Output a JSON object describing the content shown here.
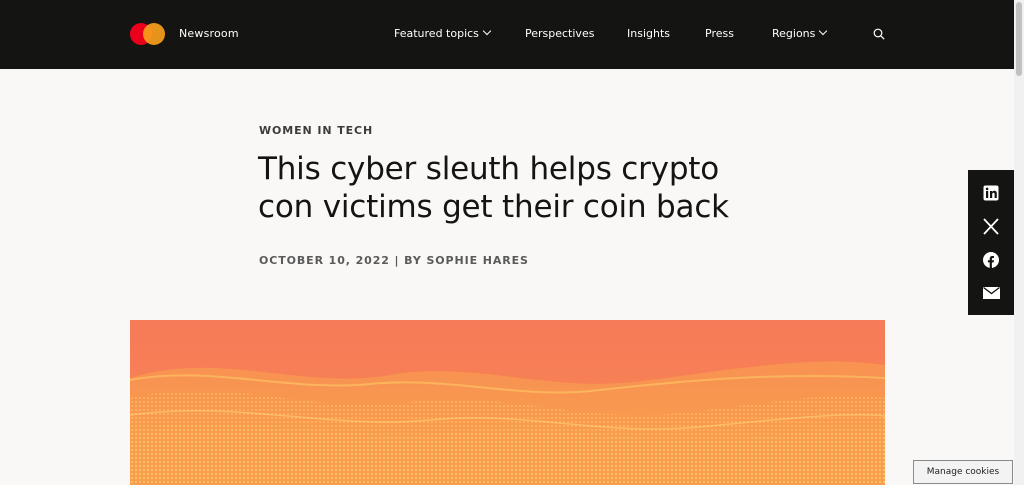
{
  "header": {
    "brand": "Newsroom",
    "nav": [
      {
        "label": "Featured topics",
        "dropdown": true
      },
      {
        "label": "Perspectives"
      },
      {
        "label": "Insights"
      },
      {
        "label": "Press"
      },
      {
        "label": "Regions",
        "dropdown": true
      }
    ],
    "search_icon": "search-icon"
  },
  "article": {
    "category": "WOMEN IN TECH",
    "title": "This cyber sleuth helps crypto con victims get their coin back",
    "byline": "OCTOBER 10, 2022 | BY SOPHIE HARES"
  },
  "share": {
    "icons": [
      "linkedin-icon",
      "x-icon",
      "facebook-icon",
      "email-icon"
    ]
  },
  "cookies": {
    "label": "Manage cookies"
  },
  "colors": {
    "header_bg": "#141413",
    "page_bg": "#f9f8f6",
    "logo_red": "#eb001b",
    "logo_orange": "#f79e1b",
    "hero_orange": "#f77f55"
  }
}
